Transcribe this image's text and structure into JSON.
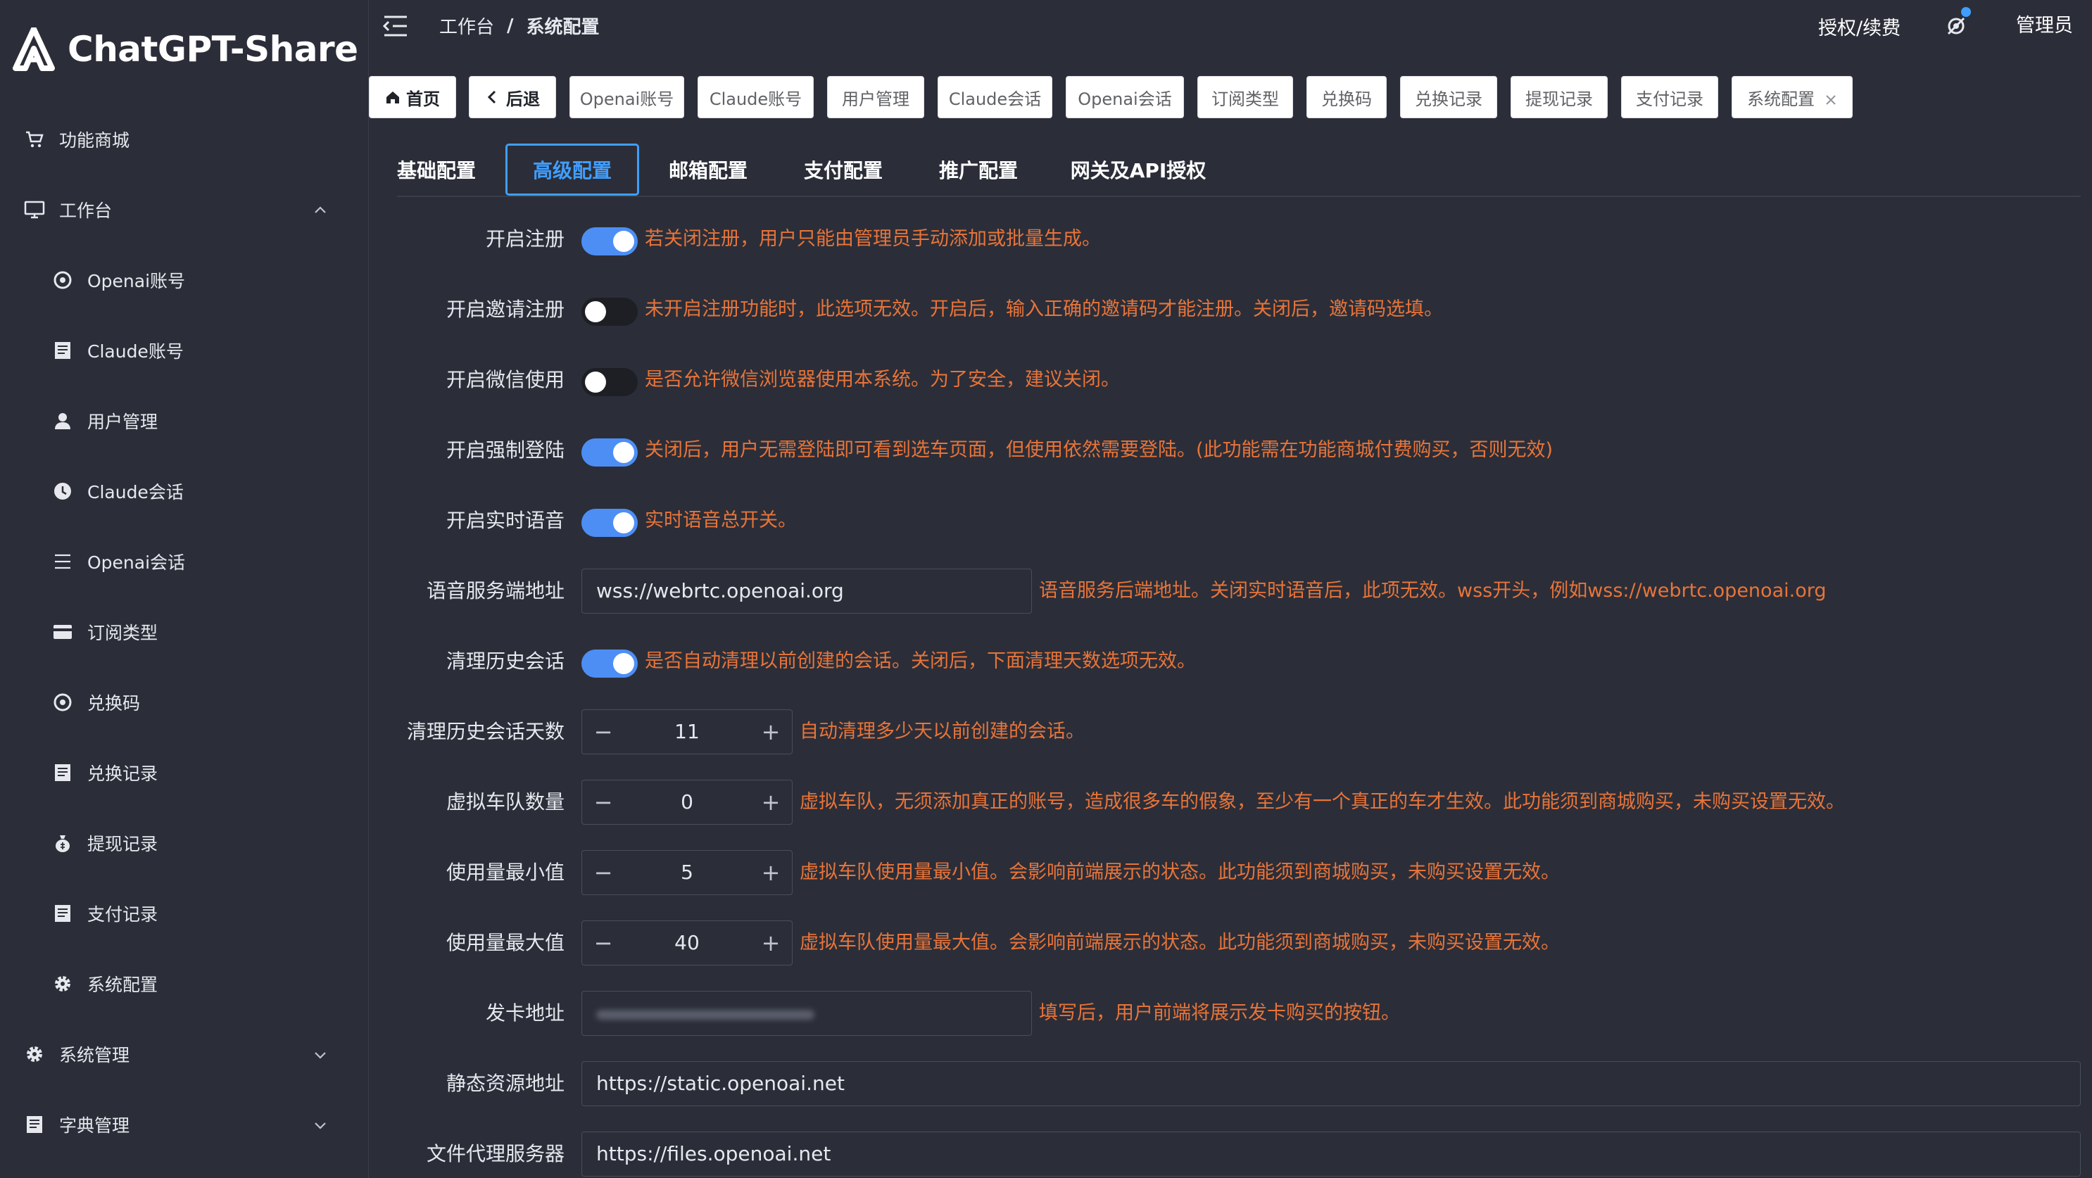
{
  "app": {
    "title": "ChatGPT-Share"
  },
  "sidebar": {
    "items": [
      {
        "label": "功能商城",
        "icon": "cart-icon"
      },
      {
        "label": "工作台",
        "icon": "monitor-icon"
      },
      {
        "label": "Openai账号",
        "icon": "openai-icon"
      },
      {
        "label": "Claude账号",
        "icon": "document-icon"
      },
      {
        "label": "用户管理",
        "icon": "user-icon"
      },
      {
        "label": "Claude会话",
        "icon": "clock-icon"
      },
      {
        "label": "Openai会话",
        "icon": "list-icon"
      },
      {
        "label": "订阅类型",
        "icon": "card-icon"
      },
      {
        "label": "兑换码",
        "icon": "openai-icon"
      },
      {
        "label": "兑换记录",
        "icon": "document-icon"
      },
      {
        "label": "提现记录",
        "icon": "moneybag-icon"
      },
      {
        "label": "支付记录",
        "icon": "document-icon"
      },
      {
        "label": "系统配置",
        "icon": "gear-icon"
      },
      {
        "label": "系统管理",
        "icon": "gear-icon"
      },
      {
        "label": "字典管理",
        "icon": "document-icon"
      }
    ]
  },
  "header": {
    "breadcrumb": [
      "工作台",
      "系统配置"
    ],
    "separator": "/",
    "license": "授权/续费",
    "user": "管理员"
  },
  "tags": [
    "首页",
    "后退",
    "Openai账号",
    "Claude账号",
    "用户管理",
    "Claude会话",
    "Openai会话",
    "订阅类型",
    "兑换码",
    "兑换记录",
    "提现记录",
    "支付记录",
    "系统配置"
  ],
  "tabs": [
    "基础配置",
    "高级配置",
    "邮箱配置",
    "支付配置",
    "推广配置",
    "网关及API授权"
  ],
  "active_tab": "高级配置",
  "form": {
    "open_register": {
      "label": "开启注册",
      "on": true,
      "hint": "若关闭注册，用户只能由管理员手动添加或批量生成。"
    },
    "invite_register": {
      "label": "开启邀请注册",
      "on": false,
      "hint": "未开启注册功能时，此选项无效。开启后，输入正确的邀请码才能注册。关闭后，邀请码选填。"
    },
    "wechat_use": {
      "label": "开启微信使用",
      "on": false,
      "hint": "是否允许微信浏览器使用本系统。为了安全，建议关闭。"
    },
    "force_login": {
      "label": "开启强制登陆",
      "on": true,
      "hint": "关闭后，用户无需登陆即可看到选车页面，但使用依然需要登陆。(此功能需在功能商城付费购买，否则无效)"
    },
    "realtime_voice": {
      "label": "开启实时语音",
      "on": true,
      "hint": "实时语音总开关。"
    },
    "voice_server": {
      "label": "语音服务端地址",
      "value": "wss://webrtc.openoai.org",
      "hint": "语音服务后端地址。关闭实时语音后，此项无效。wss开头，例如wss://webrtc.openoai.org"
    },
    "clean_history": {
      "label": "清理历史会话",
      "on": true,
      "hint": "是否自动清理以前创建的会话。关闭后，下面清理天数选项无效。"
    },
    "clean_days": {
      "label": "清理历史会话天数",
      "value": "11",
      "hint": "自动清理多少天以前创建的会话。"
    },
    "virtual_fleet": {
      "label": "虚拟车队数量",
      "value": "0",
      "hint": "虚拟车队，无须添加真正的账号，造成很多车的假象，至少有一个真正的车才生效。此功能须到商城购买，未购买设置无效。"
    },
    "usage_min": {
      "label": "使用量最小值",
      "value": "5",
      "hint": "虚拟车队使用量最小值。会影响前端展示的状态。此功能须到商城购买，未购买设置无效。"
    },
    "usage_max": {
      "label": "使用量最大值",
      "value": "40",
      "hint": "虚拟车队使用量最大值。会影响前端展示的状态。此功能须到商城购买，未购买设置无效。"
    },
    "card_address": {
      "label": "发卡地址",
      "hint": "填写后，用户前端将展示发卡购买的按钮。"
    },
    "static_url": {
      "label": "静态资源地址",
      "value": "https://static.openoai.net"
    },
    "file_proxy": {
      "label": "文件代理服务器",
      "value": "https://files.openoai.net"
    }
  },
  "colors": {
    "accent": "#409eff",
    "switch_on": "#4d8ef5",
    "hint": "#e8743a",
    "bg": "#2b2e38"
  }
}
